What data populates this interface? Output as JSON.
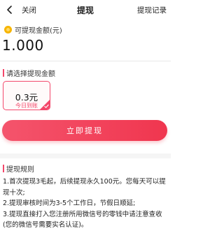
{
  "header": {
    "close_label": "关闭",
    "title": "提现",
    "records_label": "提现记录"
  },
  "balance": {
    "label": "可提现金额(元)",
    "value": "1.000"
  },
  "options": {
    "section_title": "请选择提现金额",
    "items": [
      {
        "amount": "0.3元",
        "note": "今日到账",
        "selected": true
      }
    ]
  },
  "withdraw_button": {
    "label": "立即提现"
  },
  "rules": {
    "section_title": "提现规则",
    "lines": [
      "1.首次提现3毛起，后续提现永久100元。您每天可以提现十次;",
      "2.提现审核时间为3-5个工作日，节假日顺延;",
      "3.提现直接打入您注册所用微信号的零钱中请注意查收(您的微信号需要实名认证)。"
    ]
  },
  "colors": {
    "accent": "#f3486b",
    "button": "#f0364f",
    "coin": "#f7b500"
  },
  "icons": {
    "back": "chevron-left-icon",
    "coin": "coin-icon",
    "selected": "check-icon"
  }
}
